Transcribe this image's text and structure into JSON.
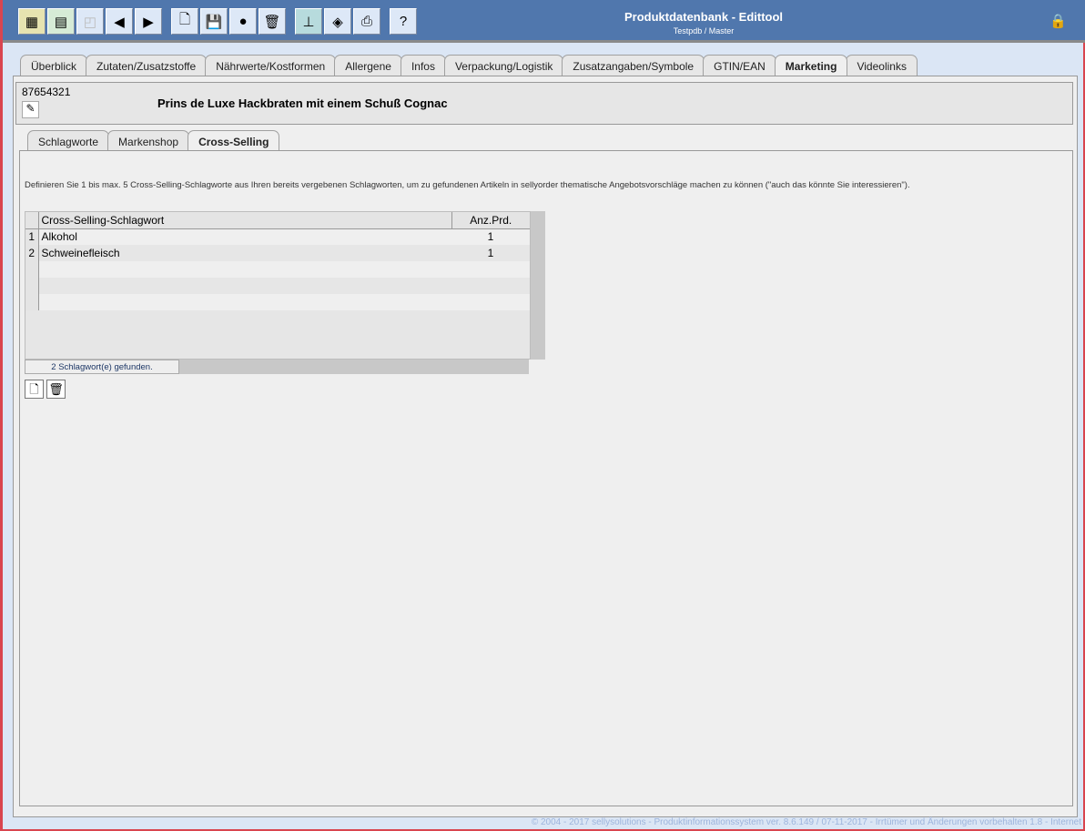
{
  "header": {
    "title": "Produktdatenbank - Edittool",
    "subtitle": "Testpdb / Master"
  },
  "toolbar": [
    "search-grid-icon",
    "table-icon",
    "folder-icon",
    "back-icon",
    "forward-icon",
    "new-document-icon",
    "save-icon",
    "globe-icon",
    "trash-icon",
    "hierarchy-icon",
    "export-icon",
    "print-icon",
    "help-icon"
  ],
  "tabs": [
    "Überblick",
    "Zutaten/Zusatzstoffe",
    "Nährwerte/Kostformen",
    "Allergene",
    "Infos",
    "Verpackung/Logistik",
    "Zusatzangaben/Symbole",
    "GTIN/EAN",
    "Marketing",
    "Videolinks"
  ],
  "active_tab": "Marketing",
  "product": {
    "id": "87654321",
    "name": "Prins de Luxe Hackbraten mit einem Schuß Cognac"
  },
  "subtabs": [
    "Schlagworte",
    "Markenshop",
    "Cross-Selling"
  ],
  "description": "Definieren Sie 1 bis max. 5 Cross-Selling-Schlagworte aus Ihren bereits vergebenen Schlagworten, um zu gefundenen Artikeln in sellyorder thematische Angebotsvorschläge machen zu können (\"auch das könnte Sie interessieren\").",
  "table": {
    "columns": [
      "Cross-Selling-Schlagwort",
      "Anz.Prd."
    ],
    "rows": [
      [
        "1",
        "Alkohol",
        "1"
      ],
      [
        "2",
        "Schweinefleisch",
        "1"
      ]
    ]
  },
  "status": "2  Schlagwort(e) gefunden.",
  "footer": "© 2004 - 2017 sellysolutions - Produktinformationssystem ver. 8.6.149 / 07-11-2017 - Irrtümer und Änderungen vorbehalten  1.8 - Internet"
}
